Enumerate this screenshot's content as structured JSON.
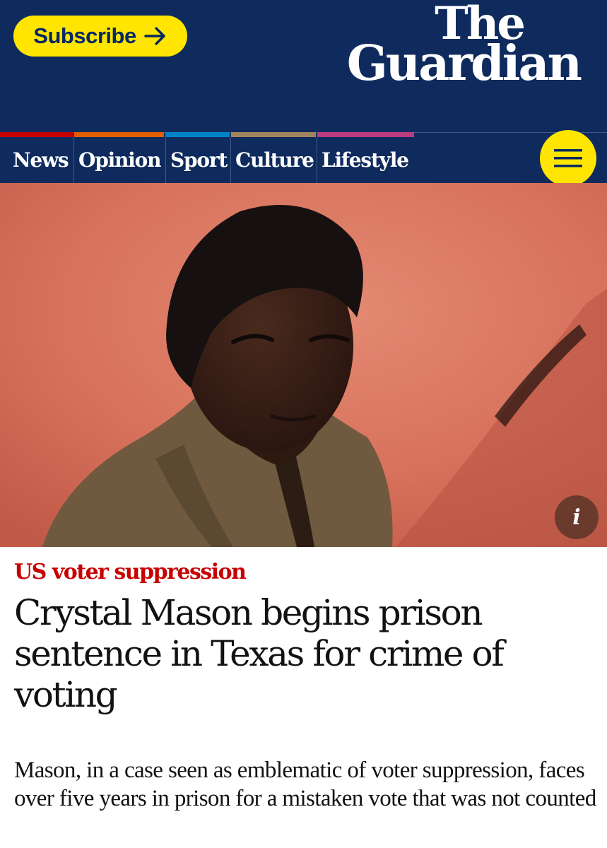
{
  "header": {
    "subscribe_label": "Subscribe",
    "logo_the": "The",
    "logo_guardian": "Guardian",
    "background": "#0f2b5e",
    "accent": "#ffe500"
  },
  "nav": {
    "items": [
      {
        "label": "News",
        "color": "#c70000"
      },
      {
        "label": "Opinion",
        "color": "#e05e00"
      },
      {
        "label": "Sport",
        "color": "#0084c6"
      },
      {
        "label": "Culture",
        "color": "#a1845c"
      },
      {
        "label": "Lifestyle",
        "color": "#bb3b80"
      }
    ],
    "menu_icon": "hamburger-icon"
  },
  "hero": {
    "info_label": "i"
  },
  "article": {
    "kicker": "US voter suppression",
    "headline": "Crystal Mason begins prison sentence in Texas for crime of voting",
    "standfirst": "Mason, in a case seen as emblematic of voter suppression, faces over five years in prison for a mistaken vote that was not counted"
  }
}
